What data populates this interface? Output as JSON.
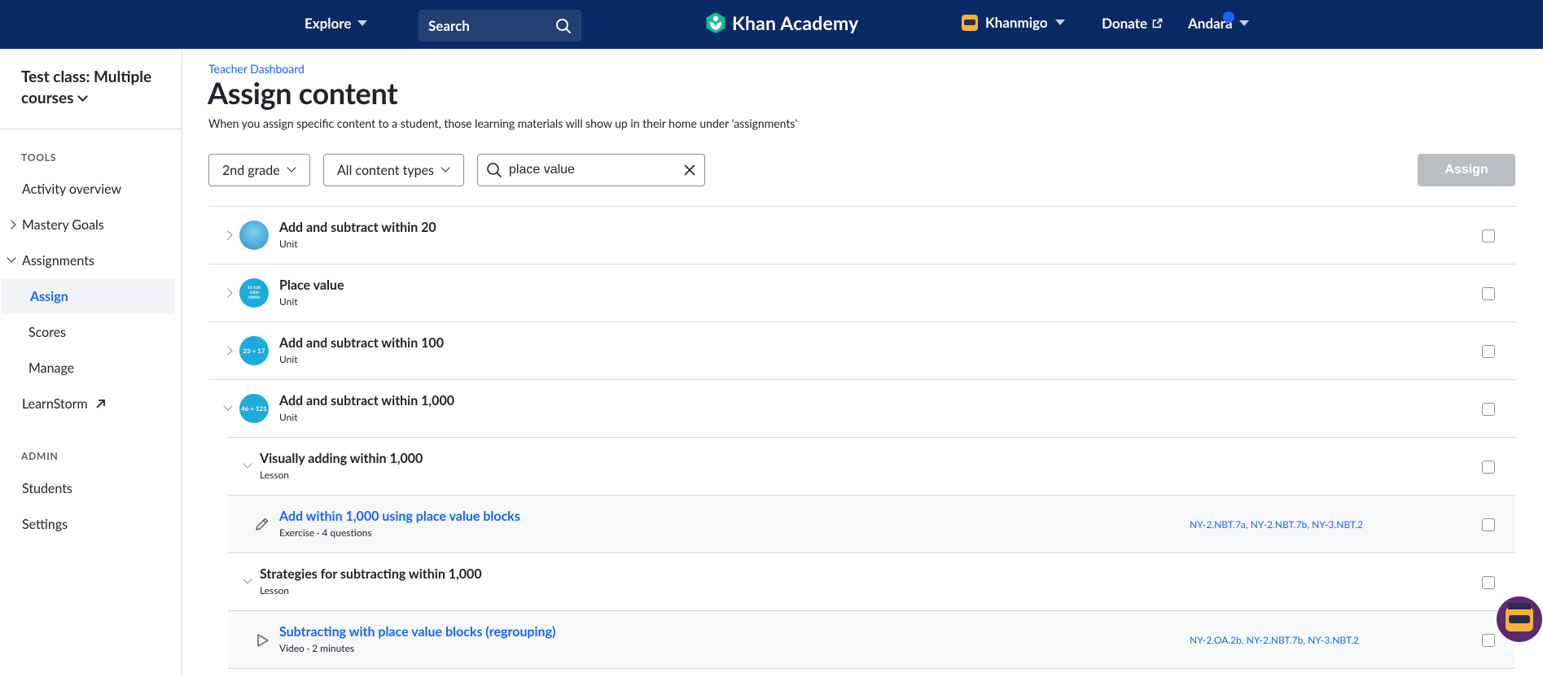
{
  "nav": {
    "explore": "Explore",
    "search_label": "Search",
    "logo_text": "Khan Academy",
    "khanmigo": "Khanmigo",
    "donate": "Donate",
    "user": "Andara"
  },
  "sidebar": {
    "class_title": "Test class: Multiple courses",
    "tools_heading": "TOOLS",
    "admin_heading": "ADMIN",
    "items": {
      "activity": "Activity overview",
      "mastery": "Mastery Goals",
      "assignments": "Assignments",
      "assign": "Assign",
      "scores": "Scores",
      "manage": "Manage",
      "learnstorm": "LearnStorm",
      "students": "Students",
      "settings": "Settings"
    }
  },
  "main": {
    "breadcrumb": "Teacher Dashboard",
    "title": "Assign content",
    "subtitle": "When you assign specific content to a student, those learning materials will show up in their home under 'assignments'",
    "filters": {
      "grade": "2nd grade",
      "content_type": "All content types",
      "search_value": "place value",
      "assign_button": "Assign"
    },
    "rows": [
      {
        "title": "Add and subtract within 20",
        "meta": "Unit",
        "icon_text": ""
      },
      {
        "title": "Place value",
        "meta": "Unit",
        "icon_text": "10 100 1000 10000"
      },
      {
        "title": "Add and subtract within 100",
        "meta": "Unit",
        "icon_text": "23 + 17"
      },
      {
        "title": "Add and subtract within 1,000",
        "meta": "Unit",
        "icon_text": "46 + 121"
      },
      {
        "title": "Visually adding within 1,000",
        "meta": "Lesson"
      },
      {
        "title": "Add within 1,000 using place value blocks",
        "meta": "Exercise · 4 questions",
        "standards": [
          "NY-2.NBT.7a",
          "NY-2.NBT.7b",
          "NY-3.NBT.2"
        ]
      },
      {
        "title": "Strategies for subtracting within 1,000",
        "meta": "Lesson"
      },
      {
        "title": "Subtracting with place value blocks (regrouping)",
        "meta": "Video · 2 minutes",
        "standards": [
          "NY-2.OA.2b",
          "NY-2.NBT.7b",
          "NY-3.NBT.2"
        ]
      }
    ]
  }
}
